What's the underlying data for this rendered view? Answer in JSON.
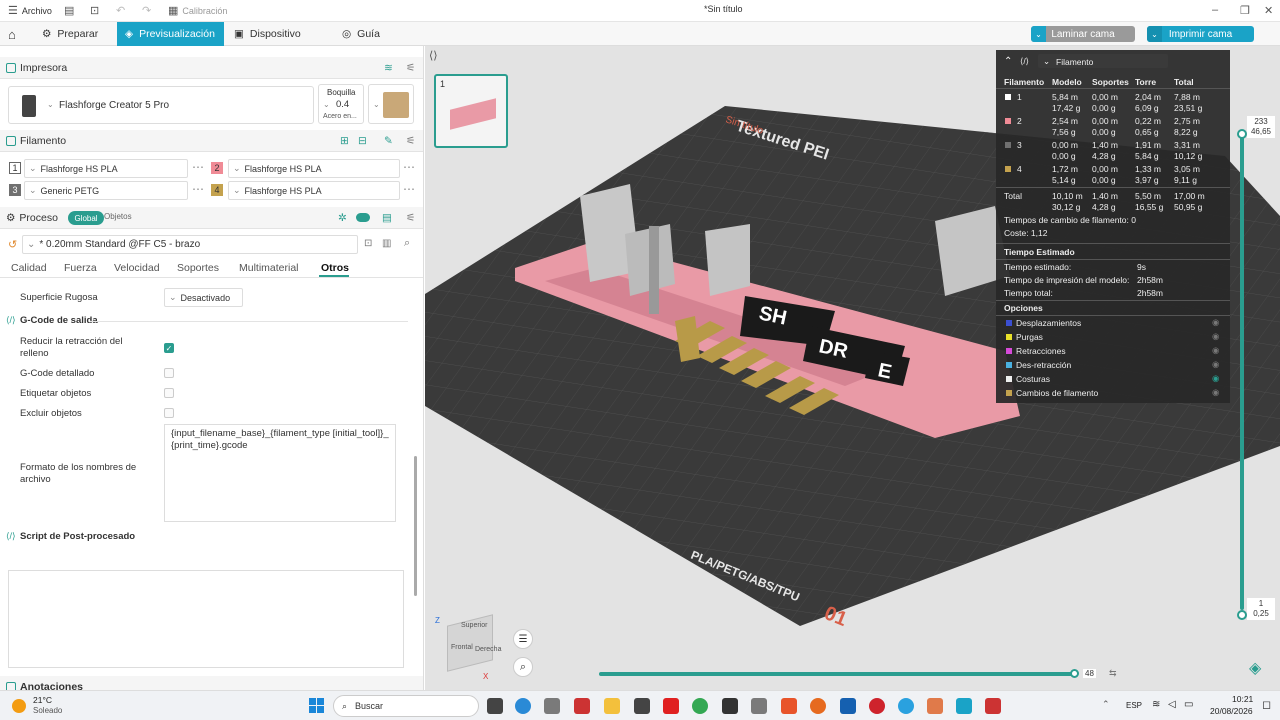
{
  "titlebar": {
    "menu": "Archivo",
    "calibration": "Calibración",
    "doc_title": "*Sin título"
  },
  "nav": {
    "prepare": "Preparar",
    "preview": "Previsualización",
    "device": "Dispositivo",
    "guide": "Guía",
    "slice": "Laminar cama",
    "print": "Imprimir cama"
  },
  "printer": {
    "section": "Impresora",
    "name": "Flashforge Creator 5 Pro",
    "nozzle_label": "Boquilla",
    "nozzle_value": "0.4",
    "nozzle_material": "Acero en..."
  },
  "filament": {
    "section": "Filamento",
    "items": [
      {
        "n": "1",
        "name": "Flashforge HS PLA",
        "color": "#ffffff"
      },
      {
        "n": "2",
        "name": "Flashforge HS PLA",
        "color": "#f08b96"
      },
      {
        "n": "3",
        "name": "Generic PETG",
        "color": "#707070"
      },
      {
        "n": "4",
        "name": "Flashforge HS PLA",
        "color": "#c4a24e"
      }
    ]
  },
  "process": {
    "section": "Proceso",
    "global": "Global",
    "objects": "Objetos",
    "preset": "* 0.20mm Standard @FF C5 - brazo",
    "tabs": [
      "Calidad",
      "Fuerza",
      "Velocidad",
      "Soportes",
      "Multimaterial",
      "Otros"
    ],
    "fuzzy_label": "Superficie Rugosa",
    "fuzzy_value": "Desactivado",
    "gcode_out": "G-Code de salida",
    "reduce_retraction": "Reducir la retracción del relleno",
    "verbose": "G-Code detallado",
    "label_objects": "Etiquetar objetos",
    "exclude_objects": "Excluir objetos",
    "filename_label": "Formato de los nombres de archivo",
    "filename_value": "{input_filename_base}_{filament_type [initial_tool]}_{print_time}.gcode",
    "post_script": "Script de Post-procesado",
    "notes": "Anotaciones"
  },
  "plate": {
    "thumb_index": "1",
    "brand_text": "Textured PEI",
    "sin_titulo": "Sin título",
    "bottom_text": "PLA/PETG/ABS/TPU",
    "plate_no": "01"
  },
  "stats": {
    "header_dropdown": "Filamento",
    "columns": [
      "Filamento",
      "Modelo",
      "Soportes",
      "Torre",
      "Total"
    ],
    "rows": [
      {
        "n": "1",
        "color": "#ffffff",
        "modelo": [
          "5,84 m",
          "17,42 g"
        ],
        "soportes": [
          "0,00 m",
          "0,00 g"
        ],
        "torre": [
          "2,04 m",
          "6,09 g"
        ],
        "total": [
          "7,88 m",
          "23,51 g"
        ]
      },
      {
        "n": "2",
        "color": "#f08b96",
        "modelo": [
          "2,54 m",
          "7,56 g"
        ],
        "soportes": [
          "0,00 m",
          "0,00 g"
        ],
        "torre": [
          "0,22 m",
          "0,65 g"
        ],
        "total": [
          "2,75 m",
          "8,22 g"
        ]
      },
      {
        "n": "3",
        "color": "#707070",
        "modelo": [
          "0,00 m",
          "0,00 g"
        ],
        "soportes": [
          "1,40 m",
          "4,28 g"
        ],
        "torre": [
          "1,91 m",
          "5,84 g"
        ],
        "total": [
          "3,31 m",
          "10,12 g"
        ]
      },
      {
        "n": "4",
        "color": "#c4a24e",
        "modelo": [
          "1,72 m",
          "5,14 g"
        ],
        "soportes": [
          "0,00 m",
          "0,00 g"
        ],
        "torre": [
          "1,33 m",
          "3,97 g"
        ],
        "total": [
          "3,05 m",
          "9,11 g"
        ]
      }
    ],
    "total": {
      "label": "Total",
      "modelo": [
        "10,10 m",
        "30,12 g"
      ],
      "soportes": [
        "1,40 m",
        "4,28 g"
      ],
      "torre": [
        "5,50 m",
        "16,55 g"
      ],
      "total": [
        "17,00 m",
        "50,95 g"
      ]
    },
    "change_time": "Tiempos de cambio de filamento:  0",
    "cost": "Coste:  1,12",
    "time_section": "Tiempo Estimado",
    "est_label": "Tiempo estimado:",
    "est_value": "9s",
    "model_time_label": "Tiempo de impresión del modelo:",
    "model_time_value": "2h58m",
    "total_time_label": "Tiempo total:",
    "total_time_value": "2h58m",
    "options_section": "Opciones",
    "options": [
      {
        "label": "Desplazamientos",
        "color": "#3b4fd1"
      },
      {
        "label": "Purgas",
        "color": "#e8e02a"
      },
      {
        "label": "Retracciones",
        "color": "#d64ad8"
      },
      {
        "label": "Des-retracción",
        "color": "#4ab0e0"
      },
      {
        "label": "Costuras",
        "color": "#eeeeee"
      },
      {
        "label": "Cambios de filamento",
        "color": "#c4a24e"
      }
    ]
  },
  "slider": {
    "top_a": "233",
    "top_b": "46,65",
    "bottom_a": "1",
    "bottom_b": "0,25",
    "horizontal": "48"
  },
  "viewcube": {
    "top": "Superior",
    "front": "Frontal",
    "right": "Derecha"
  },
  "taskbar": {
    "temp": "21°C",
    "weather": "Soleado",
    "search": "Buscar",
    "lang": "ESP",
    "time": "10:21",
    "date": "20/08/2026"
  },
  "colors": {
    "accent": "#1aa3c7",
    "teal": "#2a9d8f",
    "bed": "#3b3b3b",
    "pink": "#e99aa6",
    "gold": "#b89a48"
  }
}
